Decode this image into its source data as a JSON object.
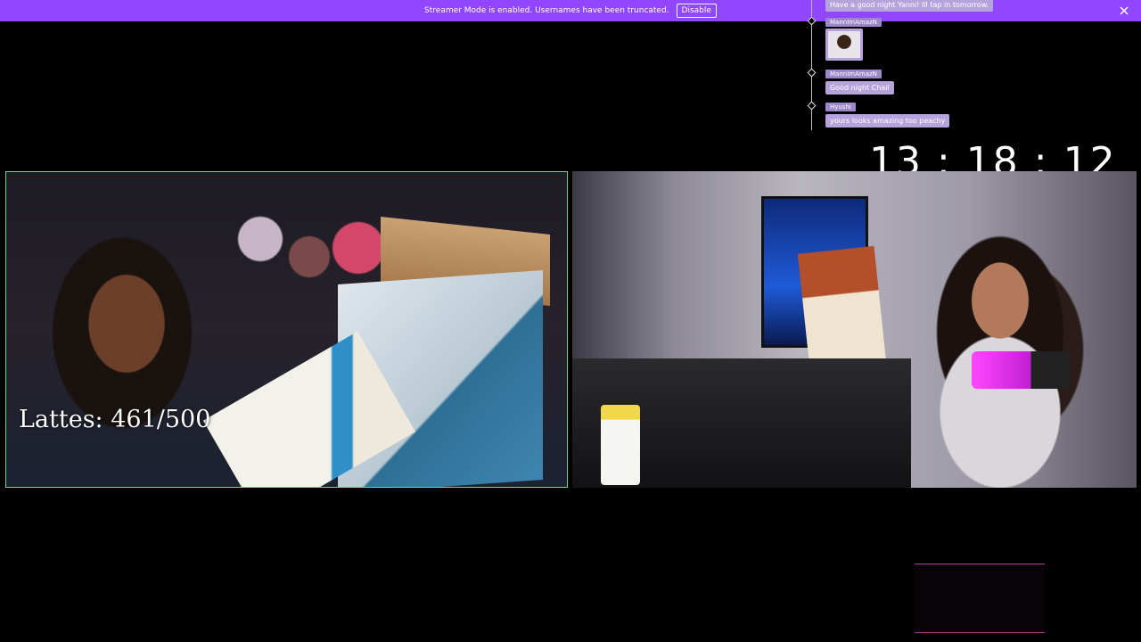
{
  "banner": {
    "message": "Streamer Mode is enabled. Usernames have been truncated.",
    "disable_label": "Disable",
    "color": "#9147ff"
  },
  "chat": {
    "messages": [
      {
        "user": "",
        "text": "Have a good night Yanni! Ill tap in tomorrow."
      },
      {
        "user": "MannImAmazN",
        "emote": "emote-image"
      },
      {
        "user": "MannImAmazN",
        "text": "Good night Chail"
      },
      {
        "user": "Hyushi",
        "text": "yours looks amazing too peachy"
      }
    ]
  },
  "timer": {
    "value": "13 : 18 : 12"
  },
  "left_cam": {
    "overlay_text": "Lattes: 461/500",
    "border_color": "#6fd68a"
  },
  "accent_colors": {
    "chat_tag": "#9b87c9",
    "chat_bubble": "#b6a3dc",
    "alert_border": "#a7449a"
  }
}
